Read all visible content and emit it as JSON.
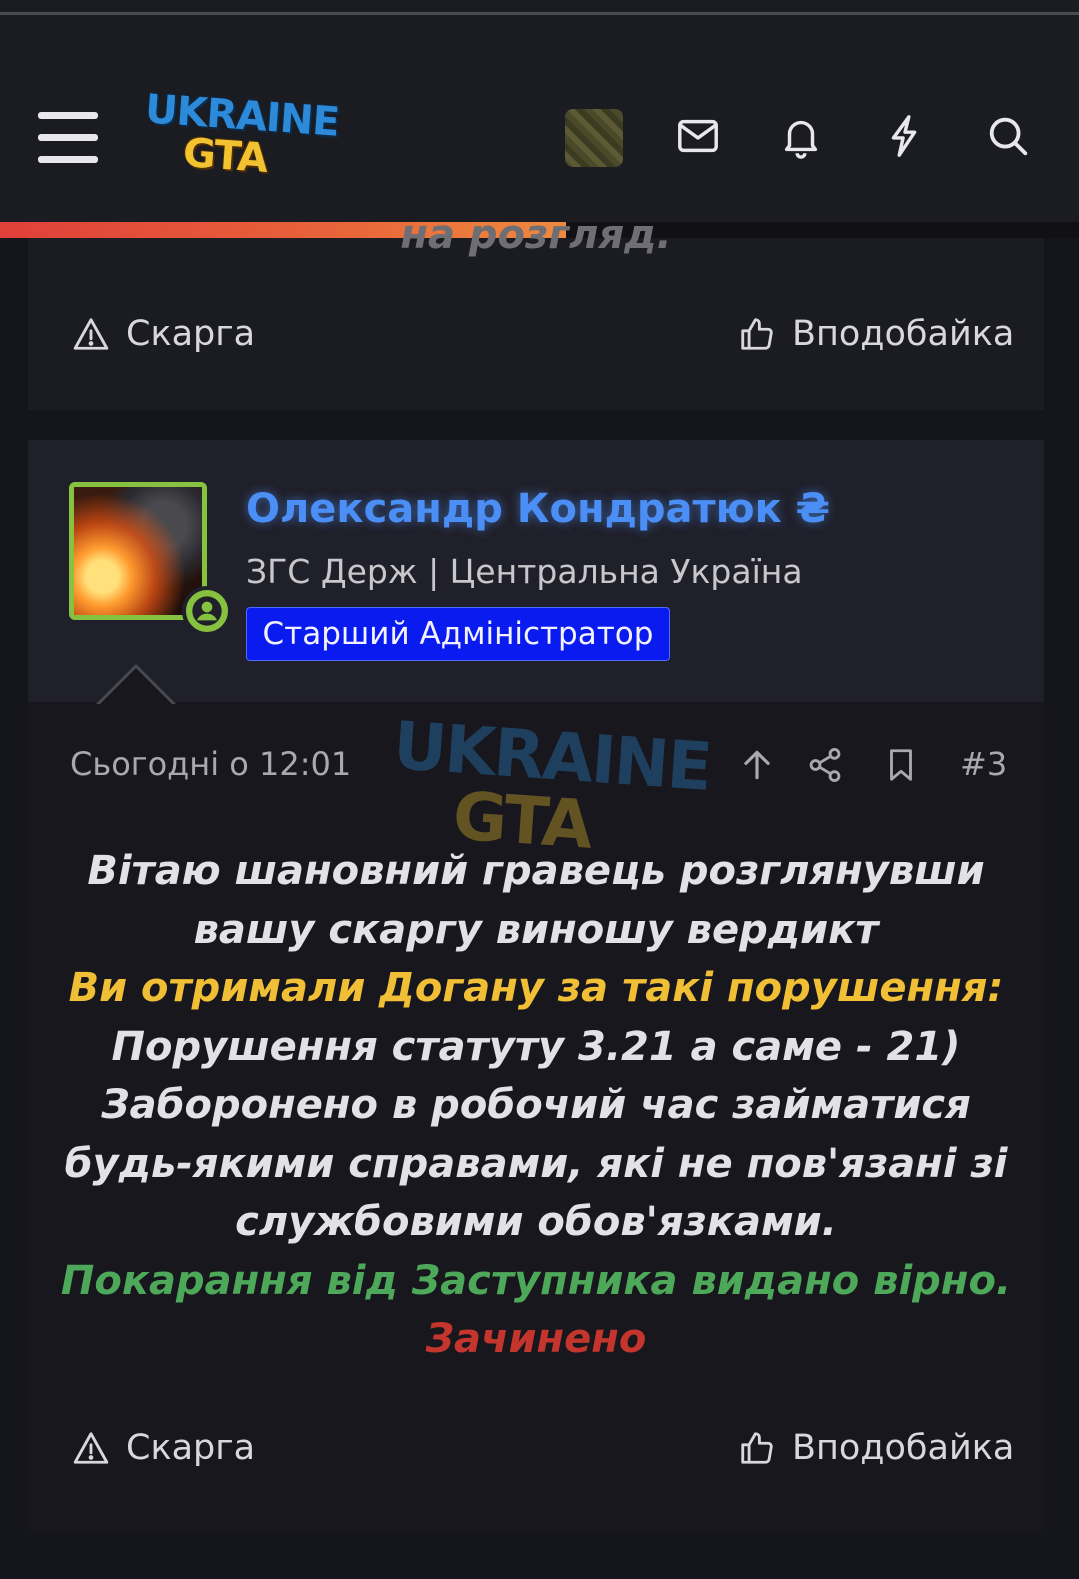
{
  "header": {
    "logo_text_top": "UKRAINE",
    "logo_text_bottom": "GTA",
    "icons": [
      "menu-icon",
      "envelope-icon",
      "bell-icon",
      "lightning-icon",
      "search-icon"
    ],
    "progress_fraction": 0.525,
    "progress_colors": [
      "#e0403a",
      "#ef8a3e"
    ]
  },
  "previous_post": {
    "cut_text": "на розгляд.",
    "report_label": "Скарга",
    "like_label": "Вподобайка"
  },
  "post": {
    "author": {
      "name": "Олександр Кондратюк ₴",
      "subtitle": "ЗГС Держ | Центральна Україна",
      "role": "Старший Адміністратор",
      "online": true,
      "name_color": "#4b8ef5",
      "role_color": "#0a1bf0"
    },
    "date": "Сьогодні о 12:01",
    "number": "#3",
    "watermark_top": "UKRAINE",
    "watermark_bottom": "GTA",
    "body_lines": [
      {
        "text": "Вітаю шановний гравець розглянувши",
        "color": "white"
      },
      {
        "text": "вашу скаргу виношу вердикт",
        "color": "white"
      },
      {
        "text": "Ви отримали Догану за такі порушення:",
        "color": "yellow"
      },
      {
        "text": "Порушення статуту 3.21 а саме - 21)",
        "color": "white"
      },
      {
        "text": "Заборонено в робочий час займатися",
        "color": "white"
      },
      {
        "text": "будь-якими справами, які не пов'язані зі",
        "color": "white"
      },
      {
        "text": "службовими обов'язками.",
        "color": "white"
      },
      {
        "text": "Покарання від Заступника видано вірно.",
        "color": "green"
      },
      {
        "text": "Зачинено",
        "color": "red"
      }
    ],
    "report_label": "Скарга",
    "like_label": "Вподобайка"
  }
}
